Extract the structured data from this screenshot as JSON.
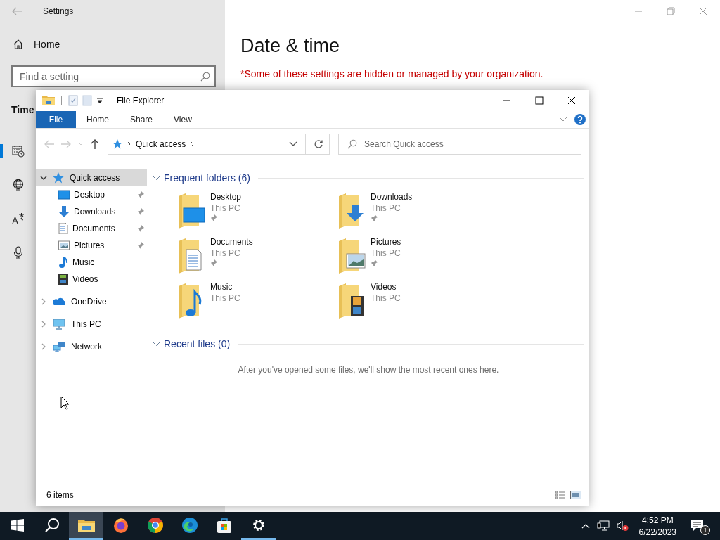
{
  "settings": {
    "title": "Settings",
    "home": "Home",
    "search": {
      "placeholder": "Find a setting"
    },
    "section": "Time",
    "nav": [
      {
        "kind": "calendar",
        "selected": true
      },
      {
        "kind": "globe",
        "selected": false
      },
      {
        "kind": "language",
        "selected": false
      },
      {
        "kind": "microphone",
        "selected": false
      }
    ],
    "heading": "Date & time",
    "notice": "*Some of these settings are hidden or managed by your organization."
  },
  "explorer": {
    "title": "File Explorer",
    "ribbon_tabs": [
      {
        "label": "File",
        "selected": true
      },
      {
        "label": "Home",
        "selected": false
      },
      {
        "label": "Share",
        "selected": false
      },
      {
        "label": "View",
        "selected": false
      }
    ],
    "address": "Quick access",
    "search": {
      "placeholder": "Search Quick access"
    },
    "nav_tree": [
      {
        "label": "Quick access",
        "kind": "star",
        "expanded": true,
        "selected": true,
        "children": [
          {
            "label": "Desktop",
            "kind": "desktop",
            "pinned": true
          },
          {
            "label": "Downloads",
            "kind": "downloads",
            "pinned": true
          },
          {
            "label": "Documents",
            "kind": "documents",
            "pinned": true
          },
          {
            "label": "Pictures",
            "kind": "pictures",
            "pinned": true
          },
          {
            "label": "Music",
            "kind": "music",
            "pinned": false
          },
          {
            "label": "Videos",
            "kind": "videos",
            "pinned": false
          }
        ]
      },
      {
        "label": "OneDrive",
        "kind": "cloud",
        "expanded": false,
        "selected": false
      },
      {
        "label": "This PC",
        "kind": "pc",
        "expanded": false,
        "selected": false
      },
      {
        "label": "Network",
        "kind": "network",
        "expanded": false,
        "selected": false
      }
    ],
    "frequent_folders": {
      "title": "Frequent folders (6)",
      "expanded": true,
      "items": [
        {
          "name": "Desktop",
          "location": "This PC",
          "kind": "desktop",
          "pinned": true
        },
        {
          "name": "Downloads",
          "location": "This PC",
          "kind": "downloads",
          "pinned": true
        },
        {
          "name": "Documents",
          "location": "This PC",
          "kind": "documents",
          "pinned": true
        },
        {
          "name": "Pictures",
          "location": "This PC",
          "kind": "pictures",
          "pinned": true
        },
        {
          "name": "Music",
          "location": "This PC",
          "kind": "music",
          "pinned": false
        },
        {
          "name": "Videos",
          "location": "This PC",
          "kind": "videos",
          "pinned": false
        }
      ]
    },
    "recent_files": {
      "title": "Recent files (0)",
      "expanded": true,
      "empty_text": "After you've opened some files, we'll show the most recent ones here."
    },
    "status": "6 items"
  },
  "taskbar": {
    "apps": [
      {
        "kind": "start",
        "active": false
      },
      {
        "kind": "search",
        "active": false
      },
      {
        "kind": "explorer",
        "active": true
      },
      {
        "kind": "firefox",
        "active": false
      },
      {
        "kind": "chrome",
        "active": false
      },
      {
        "kind": "edge",
        "active": false
      },
      {
        "kind": "store",
        "active": false
      },
      {
        "kind": "settings",
        "active": true
      }
    ],
    "time": "4:52 PM",
    "date": "6/22/2023",
    "notifications": "1"
  }
}
